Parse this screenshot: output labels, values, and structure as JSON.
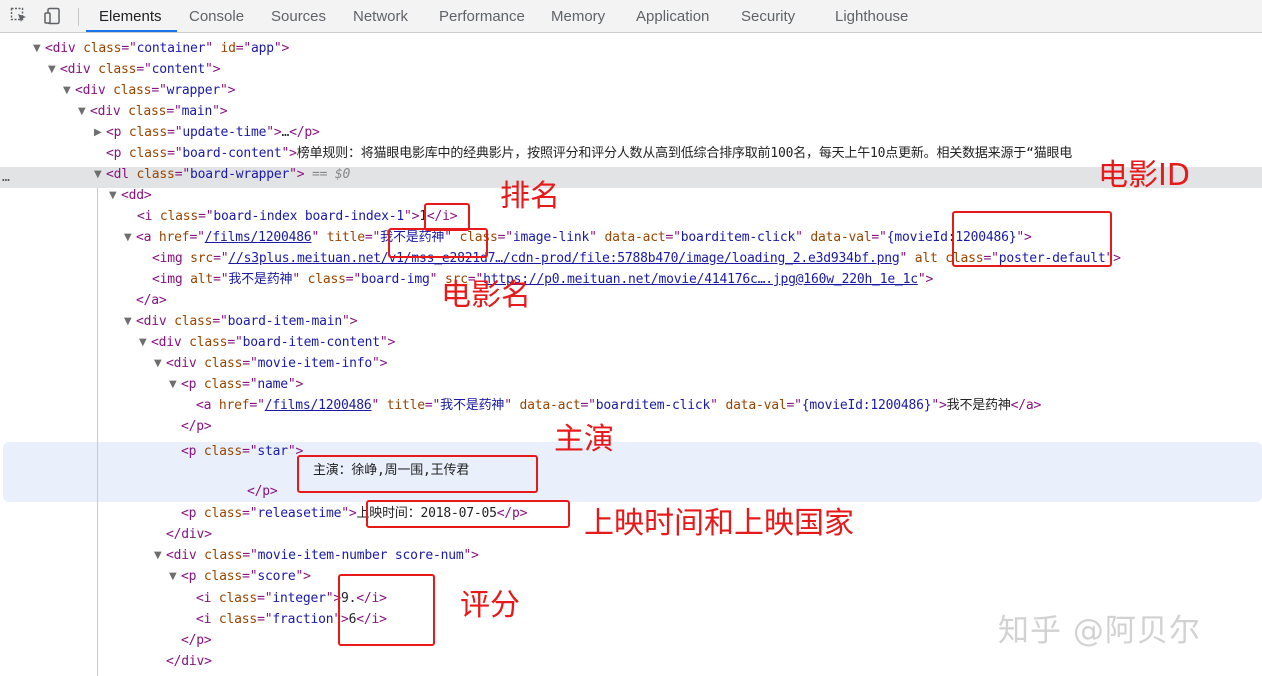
{
  "toolbar": {
    "icons": [
      "inspect-icon",
      "device-toggle-icon"
    ],
    "tabs": [
      "Elements",
      "Console",
      "Sources",
      "Network",
      "Performance",
      "Memory",
      "Application",
      "Security",
      "Lighthouse"
    ],
    "active_tab": "Elements"
  },
  "code": {
    "l1": {
      "tag": "div",
      "a1": "class",
      "v1": "container",
      "a2": "id",
      "v2": "app"
    },
    "l2": {
      "tag": "div",
      "a1": "class",
      "v1": "content"
    },
    "l3": {
      "tag": "div",
      "a1": "class",
      "v1": "wrapper"
    },
    "l4": {
      "tag": "div",
      "a1": "class",
      "v1": "main"
    },
    "l5": {
      "tag": "p",
      "a1": "class",
      "v1": "update-time",
      "rest": "…",
      "close": "</p>"
    },
    "l6": {
      "tag": "p",
      "a1": "class",
      "v1": "board-content",
      "text": "榜单规则：将猫眼电影库中的经典影片，按照评分和评分人数从高到低综合排序取前100名，每天上午10点更新。相关数据来源于“猫眼电"
    },
    "l7": {
      "tag": "dl",
      "a1": "class",
      "v1": "board-wrapper",
      "eq": "== $0",
      "dots": "…"
    },
    "l8": {
      "tag": "dd"
    },
    "l9": {
      "tag": "i",
      "a1": "class",
      "v1": "board-index board-index-1",
      "text": "1",
      "close": "</i>"
    },
    "l10": {
      "tag": "a",
      "a1": "href",
      "v1": "/films/1200486",
      "a2": "title",
      "v2": "我不是药神",
      "a3": "class",
      "v3": "image-link",
      "a4": "data-act",
      "v4": "boarditem-click",
      "a5": "data-val",
      "v5": "{movieId:1200486}"
    },
    "l11": {
      "tag": "img",
      "a1": "src",
      "v1": "//s3plus.meituan.net/v1/mss_e2821d7…/cdn-prod/file:5788b470/image/loading_2.e3d934bf.png",
      "a2": "alt",
      "a3": "class",
      "v3": "poster-default"
    },
    "l12": {
      "tag": "img",
      "a1": "alt",
      "v1": "我不是药神",
      "a2": "class",
      "v2": "board-img",
      "a3": "src",
      "v3": "https://p0.meituan.net/movie/414176c….jpg@160w_220h_1e_1c"
    },
    "l13": {
      "close": "</a>"
    },
    "l14": {
      "tag": "div",
      "a1": "class",
      "v1": "board-item-main"
    },
    "l15": {
      "tag": "div",
      "a1": "class",
      "v1": "board-item-content"
    },
    "l16": {
      "tag": "div",
      "a1": "class",
      "v1": "movie-item-info"
    },
    "l17": {
      "tag": "p",
      "a1": "class",
      "v1": "name"
    },
    "l18": {
      "tag": "a",
      "a1": "href",
      "v1": "/films/1200486",
      "a2": "title",
      "v2": "我不是药神",
      "a3": "data-act",
      "v3": "boarditem-click",
      "a4": "data-val",
      "v4": "{movieId:1200486}",
      "text": "我不是药神",
      "close": "</a>"
    },
    "l19": {
      "close": "</p>"
    },
    "l20": {
      "tag": "p",
      "a1": "class",
      "v1": "star"
    },
    "l21": {
      "text": "主演：徐峥,周一围,王传君"
    },
    "l22": {
      "close": "</p>"
    },
    "l23": {
      "tag": "p",
      "a1": "class",
      "v1": "releasetime",
      "text": "上映时间：2018-07-05",
      "close": "</p>"
    },
    "l24": {
      "close": "</div>"
    },
    "l25": {
      "tag": "div",
      "a1": "class",
      "v1": "movie-item-number score-num"
    },
    "l26": {
      "tag": "p",
      "a1": "class",
      "v1": "score"
    },
    "l27": {
      "tag": "i",
      "a1": "class",
      "v1": "integer",
      "text": "9.",
      "close": "</i>"
    },
    "l28": {
      "tag": "i",
      "a1": "class",
      "v1": "fraction",
      "text": "6",
      "close": "</i>"
    },
    "l29": {
      "close": "</p>"
    },
    "l30": {
      "close": "</div>"
    }
  },
  "annotations": {
    "rank": "排名",
    "movie_id": "电影ID",
    "movie_name": "电影名",
    "stars": "主演",
    "release": "上映时间和上映国家",
    "score": "评分",
    "color": "#e8191a"
  },
  "watermark": "知乎 @阿贝尔"
}
